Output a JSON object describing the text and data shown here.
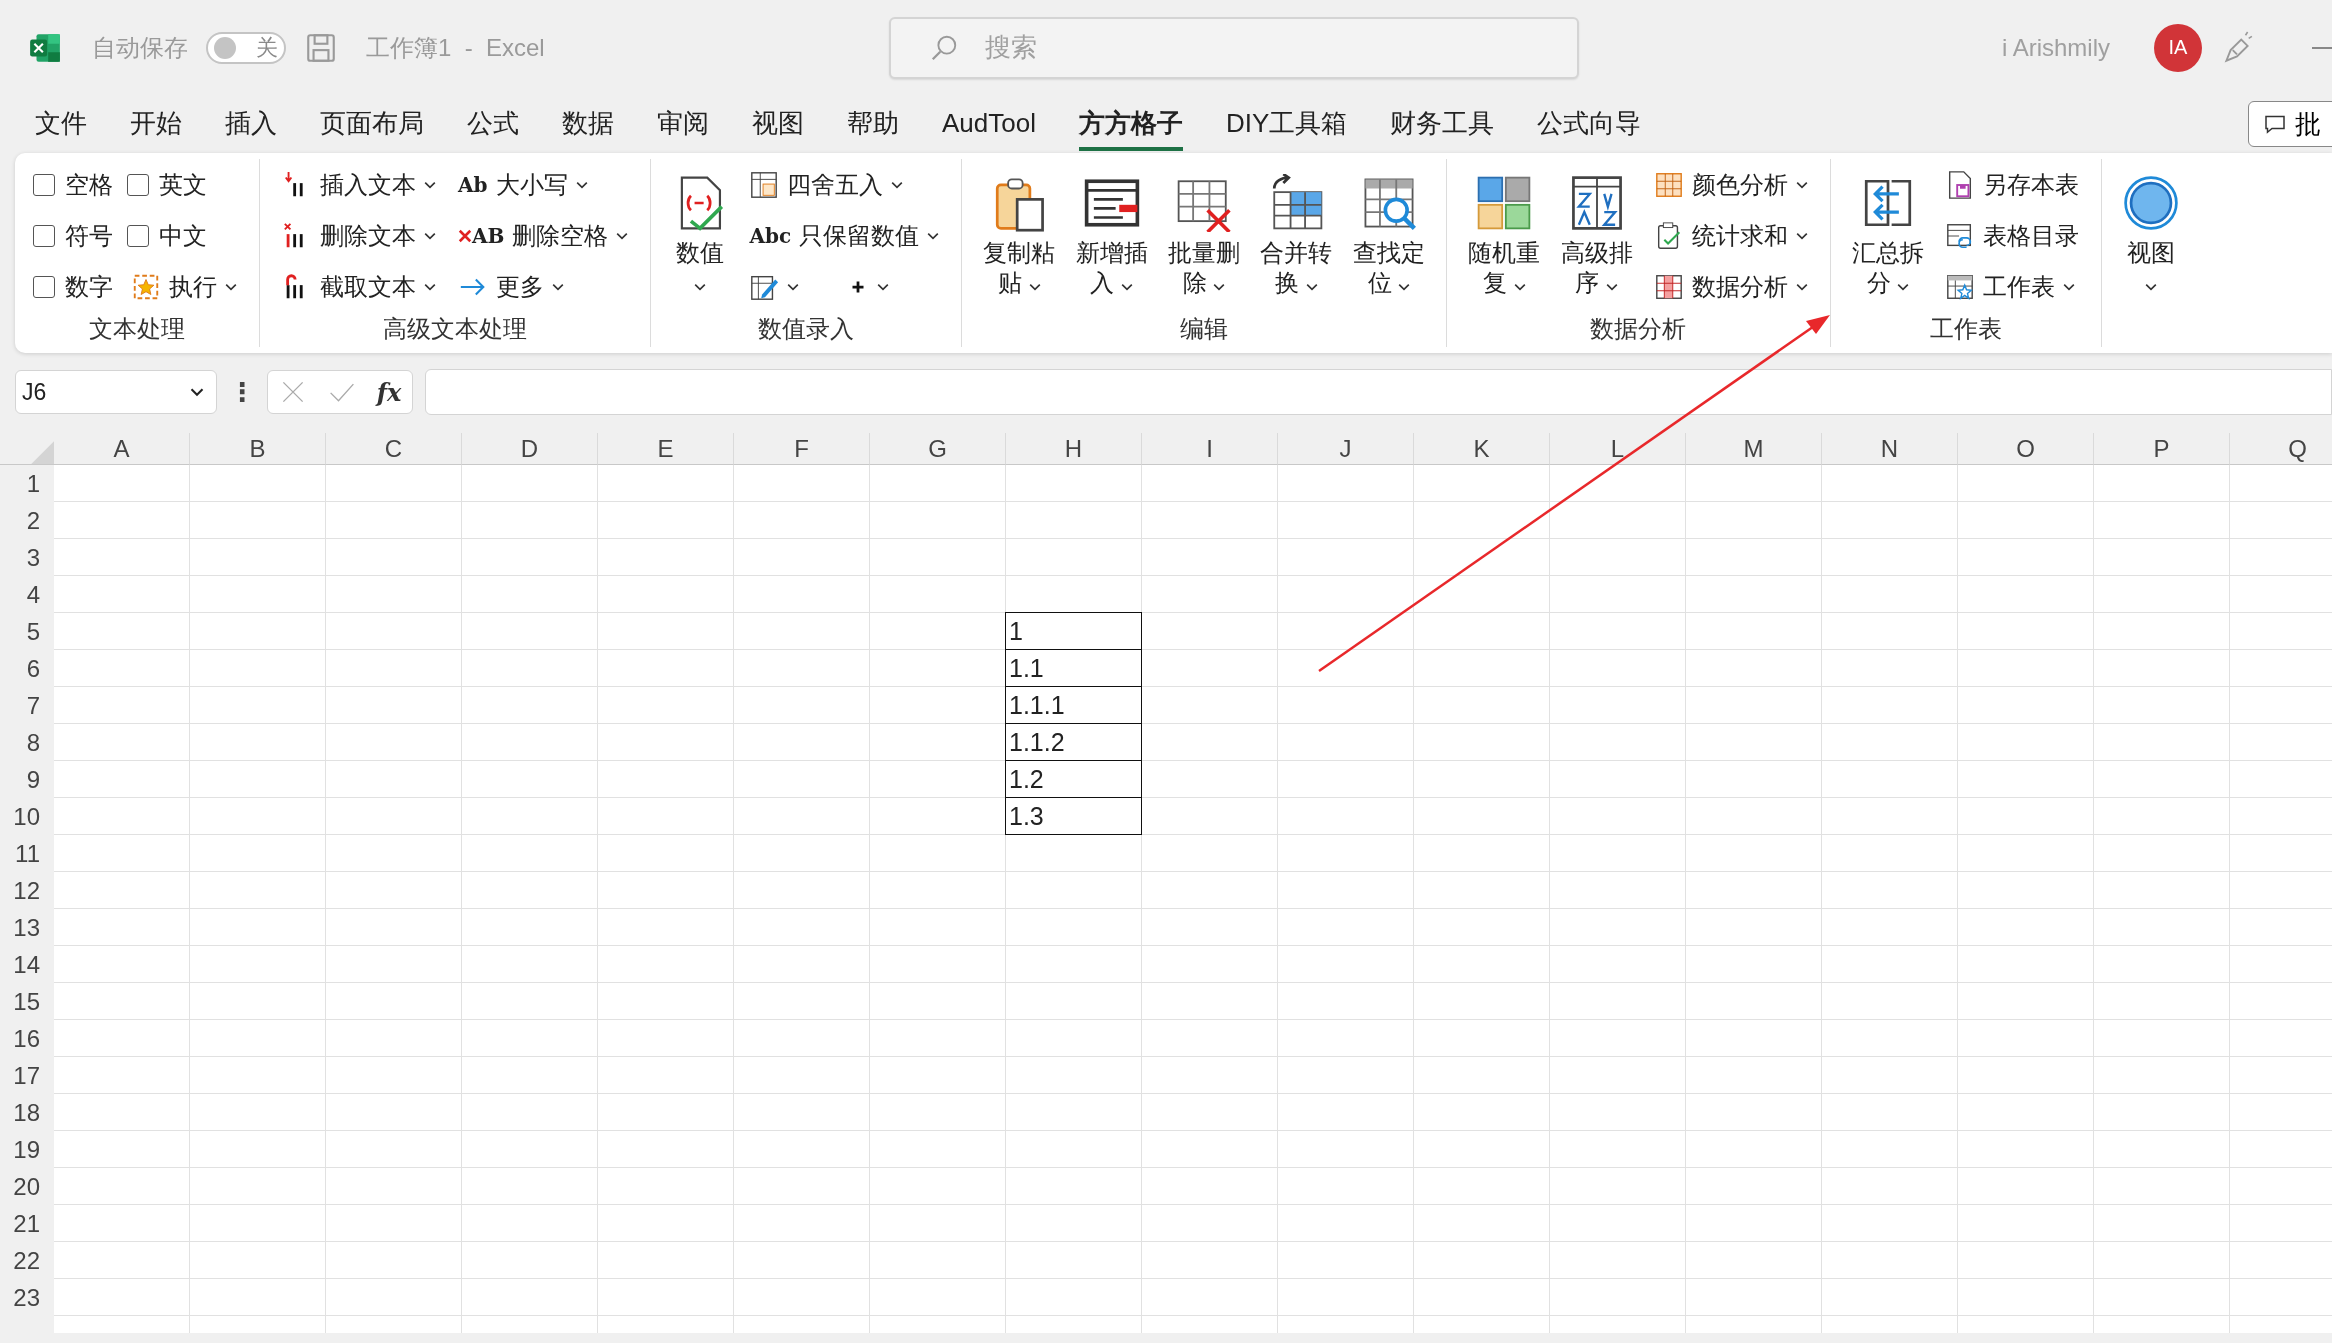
{
  "title_bar": {
    "autosave_label": "自动保存",
    "autosave_toggle": {
      "on": false,
      "label": "关"
    },
    "document_title": "工作簿1  -  Excel",
    "search": {
      "placeholder": "搜索"
    },
    "user_name": "i Arishmily",
    "avatar_initials": "IA"
  },
  "menu_tabs": [
    {
      "label": "文件",
      "selected": false
    },
    {
      "label": "开始",
      "selected": false
    },
    {
      "label": "插入",
      "selected": false
    },
    {
      "label": "页面布局",
      "selected": false
    },
    {
      "label": "公式",
      "selected": false
    },
    {
      "label": "数据",
      "selected": false
    },
    {
      "label": "审阅",
      "selected": false
    },
    {
      "label": "视图",
      "selected": false
    },
    {
      "label": "帮助",
      "selected": false
    },
    {
      "label": "AudTool",
      "selected": false
    },
    {
      "label": "方方格子",
      "selected": true
    },
    {
      "label": "DIY工具箱",
      "selected": false
    },
    {
      "label": "财务工具",
      "selected": false
    },
    {
      "label": "公式向导",
      "selected": false
    }
  ],
  "comments_button": "批",
  "ribbon": {
    "groups": [
      {
        "label": "文本处理",
        "columns": [
          [
            {
              "kind": "checkbox",
              "label": "空格",
              "checked": false
            },
            {
              "kind": "checkbox",
              "label": "符号",
              "checked": false
            },
            {
              "kind": "checkbox",
              "label": "数字",
              "checked": false
            }
          ],
          [
            {
              "kind": "checkbox",
              "label": "英文",
              "checked": false
            },
            {
              "kind": "checkbox",
              "label": "中文",
              "checked": false
            },
            {
              "kind": "small",
              "label": "执行",
              "dropdown": true
            }
          ]
        ]
      },
      {
        "label": "高级文本处理",
        "columns": [
          [
            {
              "kind": "small",
              "label": "插入文本",
              "dropdown": true
            },
            {
              "kind": "small",
              "label": "删除文本",
              "dropdown": true
            },
            {
              "kind": "small",
              "label": "截取文本",
              "dropdown": true
            }
          ],
          [
            {
              "kind": "small",
              "label": "大小写",
              "glyph": "Ab",
              "dropdown": true
            },
            {
              "kind": "small",
              "label": "删除空格",
              "glyph": "AB",
              "dropdown": true
            },
            {
              "kind": "small",
              "label": "更多",
              "dropdown": true
            }
          ]
        ]
      },
      {
        "label": "数值录入",
        "columns": [
          [
            {
              "kind": "large",
              "label": "数值",
              "dropdown": true
            }
          ],
          [
            {
              "kind": "small",
              "label": "四舍五入",
              "dropdown": true
            },
            {
              "kind": "small",
              "label": "只保留数值",
              "glyph": "Abc",
              "dropdown": true
            },
            {
              "kind": "icons",
              "buttons": [
                {
                  "dropdown": true
                },
                {
                  "dropdown": true
                }
              ]
            }
          ]
        ]
      },
      {
        "label": "编辑",
        "columns": [
          [
            {
              "kind": "large",
              "label": "复制粘贴",
              "dropdown": true
            }
          ],
          [
            {
              "kind": "large",
              "label": "新增插入",
              "dropdown": true
            }
          ],
          [
            {
              "kind": "large",
              "label": "批量删除",
              "dropdown": true
            }
          ],
          [
            {
              "kind": "large",
              "label": "合并转换",
              "dropdown": true
            }
          ],
          [
            {
              "kind": "large",
              "label": "查找定位",
              "dropdown": true
            }
          ]
        ]
      },
      {
        "label": "数据分析",
        "columns": [
          [
            {
              "kind": "large",
              "label": "随机重复",
              "dropdown": true
            }
          ],
          [
            {
              "kind": "large",
              "label": "高级排序",
              "dropdown": true
            }
          ],
          [
            {
              "kind": "small",
              "label": "颜色分析",
              "dropdown": true
            },
            {
              "kind": "small",
              "label": "统计求和",
              "dropdown": true
            },
            {
              "kind": "small",
              "label": "数据分析",
              "dropdown": true
            }
          ]
        ]
      },
      {
        "label": "工作表",
        "columns": [
          [
            {
              "kind": "large",
              "label": "汇总拆分",
              "dropdown": true
            }
          ],
          [
            {
              "kind": "small",
              "label": "另存本表",
              "dropdown": false
            },
            {
              "kind": "small",
              "label": "表格目录",
              "dropdown": false
            },
            {
              "kind": "small",
              "label": "工作表",
              "dropdown": true
            }
          ]
        ]
      },
      {
        "columns": [
          [
            {
              "kind": "large",
              "label": "视图",
              "dropdown": true
            }
          ]
        ]
      }
    ]
  },
  "formula_bar": {
    "name_box": "J6",
    "more_glyph": "⋮",
    "function_label": "fx"
  },
  "sheet": {
    "columns": [
      "A",
      "B",
      "C",
      "D",
      "E",
      "F",
      "G",
      "H",
      "I",
      "J",
      "K",
      "L",
      "M",
      "N",
      "O",
      "P",
      "Q"
    ],
    "rows": [
      "1",
      "2",
      "3",
      "4",
      "5",
      "6",
      "7",
      "8",
      "9",
      "10",
      "11",
      "12",
      "13",
      "14",
      "15",
      "16",
      "17",
      "18",
      "19",
      "20",
      "21",
      "22",
      "23"
    ],
    "bordered_range": {
      "values": [
        "1",
        "1.1",
        "1.1.1",
        "1.1.2",
        "1.2",
        "1.3"
      ]
    }
  }
}
